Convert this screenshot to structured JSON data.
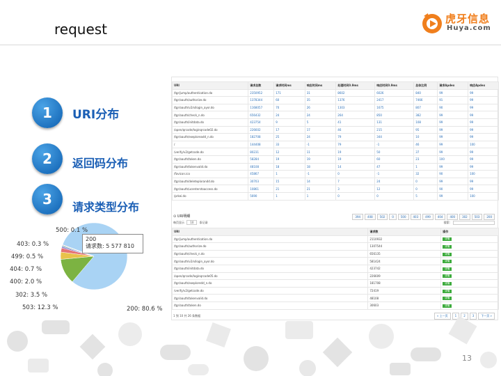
{
  "slide": {
    "title": "request",
    "page_number": "13"
  },
  "logo": {
    "cn": "虎牙信息",
    "en": "Huya.com",
    "icon": "huya-logo-icon",
    "color": "#f07f1d"
  },
  "agenda": [
    {
      "num": "1",
      "label": "URI分布"
    },
    {
      "num": "2",
      "label": "返回码分布"
    },
    {
      "num": "3",
      "label": "请求类型分布"
    }
  ],
  "pie": {
    "tooltip_code": "200",
    "tooltip_value": "请求数: 5 577 810",
    "labels": [
      "500: 0.1 %",
      "403: 0.3 %",
      "499: 0.5 %",
      "404: 0.7 %",
      "400: 2.0 %",
      "302: 3.5 %",
      "503: 12.3 %",
      "200: 80.6 %"
    ]
  },
  "chart_data": {
    "type": "pie",
    "categories": [
      "200",
      "503",
      "302",
      "400",
      "404",
      "499",
      "403",
      "500"
    ],
    "values": [
      80.6,
      12.3,
      3.5,
      2.0,
      0.7,
      0.5,
      0.3,
      0.1
    ],
    "colors": [
      "#a9d3f4",
      "#7cb342",
      "#e8c24a",
      "#e57373",
      "#9575cd",
      "#4db6ac",
      "#f48fb1",
      "#90a4ae"
    ]
  },
  "table1": {
    "headers": [
      "URI",
      "请求总数",
      "请求时间ms",
      "响应时间ms",
      "处理时间0.9ms",
      "响应时间0.9ms",
      "总体比例",
      "请求Apdex",
      "响应Apdex"
    ],
    "rows": [
      [
        "/tgr/jump/authentication.do",
        "2350952",
        "171",
        "31",
        "8602",
        "6026",
        "840",
        "99",
        "99"
      ],
      [
        "/tgr/oauth/authorize.do",
        "1378344",
        "60",
        "35",
        "1376",
        "2417",
        "7466",
        "91",
        "99"
      ],
      [
        "/tgr/oauth/v2/x/login_ayor.do",
        "1168057",
        "70",
        "26",
        "1303",
        "1675",
        "807",
        "90",
        "99"
      ],
      [
        "/tgr/oauth/check_n.do",
        "656432",
        "24",
        "24",
        "264",
        "850",
        "382",
        "99",
        "99"
      ],
      [
        "/tgr/oauth/initdata.do",
        "423754",
        "9",
        "5",
        "41",
        "131",
        "108",
        "99",
        "99"
      ],
      [
        "/open/qrcode/loginqrcode02.do",
        "226602",
        "17",
        "17",
        "46",
        "215",
        "95",
        "99",
        "99"
      ],
      [
        "/tgr/oauth/exeploreadd_n.do",
        "182708",
        "25",
        "24",
        "79",
        "344",
        "10",
        "99",
        "99"
      ],
      [
        "/",
        "144408",
        "33",
        "-1",
        "79",
        "-1",
        "46",
        "99",
        "100"
      ],
      [
        "/verify/v2/getcode.do",
        "80231",
        "12",
        "11",
        "19",
        "50",
        "37",
        "99",
        "99"
      ],
      [
        "/tgr/oauth/token.do",
        "58284",
        "19",
        "19",
        "19",
        "60",
        "23",
        "100",
        "99"
      ],
      [
        "/tgr/oauth/tokenvalid.do",
        "48108",
        "18",
        "18",
        "14",
        "47",
        "1",
        "99",
        "99"
      ],
      [
        "/favicon.ico",
        "45867",
        "1",
        "-1",
        "0",
        "-1",
        "32",
        "90",
        "100"
      ],
      [
        "/tgr/oauth/deleteplorandd.do",
        "30703",
        "15",
        "14",
        "7",
        "24",
        "0",
        "99",
        "99"
      ],
      [
        "/tgr/oauth/ucenterstoaccess.do",
        "10861",
        "21",
        "21",
        "3",
        "12",
        "0",
        "90",
        "99"
      ],
      [
        "/prkei.do",
        "5690",
        "1",
        "1",
        "0",
        "0",
        "5",
        "99",
        "100"
      ]
    ]
  },
  "pager1": [
    "394",
    "408",
    "502",
    "0",
    "500",
    "403",
    "499",
    "404",
    "400",
    "302",
    "503",
    "200"
  ],
  "table2_section": {
    "title": "⊙ URI明细",
    "show_text": "每页显示",
    "per_page": "10",
    "records_text": "条记录",
    "search_label": "搜索:"
  },
  "table2": {
    "headers": [
      "URI",
      "请求数",
      "操作"
    ],
    "button_label": "详情",
    "rows": [
      [
        "/tgr/jump/authentication.do",
        "2110932"
      ],
      [
        "/tgr/oauth/authorize.do",
        "1307544"
      ],
      [
        "/tgr/oauth/check_n.do",
        "656135"
      ],
      [
        "/tgr/oauth/v2/x/login_ayor.do",
        "581424"
      ],
      [
        "/tgr/oauth/initdata.do",
        "423742"
      ],
      [
        "/open/qrcode/loginqrcode05.do",
        "226609"
      ],
      [
        "/tgr/oauth/exeploredd_n.do",
        "181708"
      ],
      [
        "/verify/v2/getcode.do",
        "72419"
      ],
      [
        "/tgr/oauth/tokenvalid.do",
        "48108"
      ],
      [
        "/tgr/oauth/token.do",
        "30603"
      ]
    ]
  },
  "table2_footer": "1 到 10 共 26 条数据",
  "pager2": [
    "« 上一页",
    "1",
    "2",
    "3",
    "下一页 »"
  ]
}
